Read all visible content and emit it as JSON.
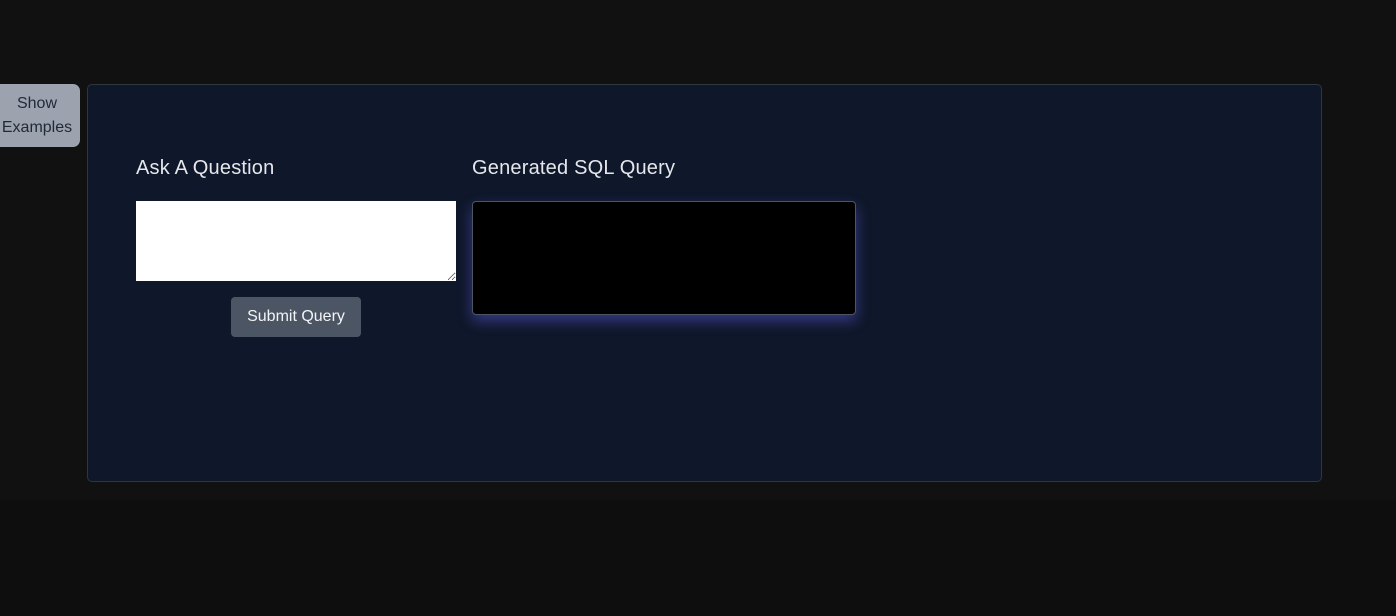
{
  "sidebar": {
    "show_examples_label": "Show\nExamples"
  },
  "main": {
    "question_label": "Ask A Question",
    "question_input": {
      "value": "",
      "placeholder": ""
    },
    "submit_label": "Submit Query",
    "sql_label": "Generated SQL Query",
    "sql_output": ""
  },
  "colors": {
    "page_background": "#111111",
    "panel_background": "#0f172a",
    "show_examples_button": "#9ca3af",
    "submit_button": "#4b5563",
    "sql_output_background": "#000000",
    "sql_output_glow": "#6366f1"
  }
}
